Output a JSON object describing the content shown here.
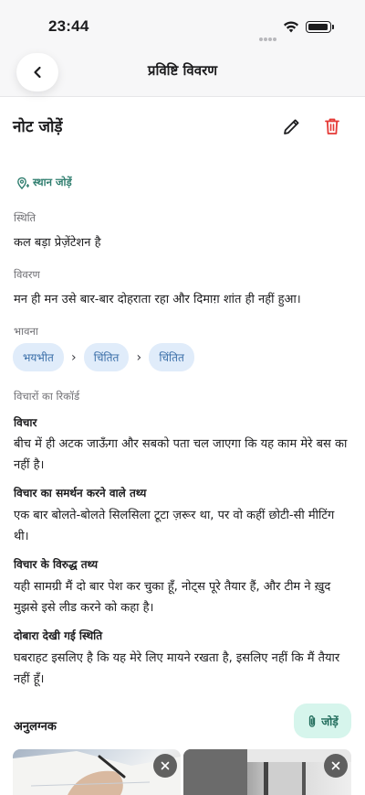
{
  "status": {
    "time": "23:44"
  },
  "nav": {
    "title": "प्रविष्टि विवरण"
  },
  "note": {
    "title": "नोट जोड़ें",
    "add_location": "स्थान जोड़ें"
  },
  "fields": {
    "situation_label": "स्थिति",
    "situation_value": "कल बड़ा प्रेज़ेंटेशन है",
    "description_label": "विवरण",
    "description_value": "मन ही मन उसे बार-बार दोहराता रहा और दिमाग़ शांत ही नहीं हुआ।",
    "emotion_label": "भावना",
    "emotions": [
      "भयभीत",
      "चिंतित",
      "चिंतित"
    ],
    "thoughts_label": "विचारों का रिकॉर्ड"
  },
  "record": {
    "thought_title": "विचार",
    "thought_value": "बीच में ही अटक जाऊँगा और सबको पता चल जाएगा कि यह काम मेरे बस का नहीं है।",
    "support_title": "विचार का समर्थन करने वाले तथ्य",
    "support_value": "एक बार बोलते-बोलते सिलसिला टूटा ज़रूर था, पर वो कहीं छोटी-सी मीटिंग थी।",
    "against_title": "विचार के विरुद्ध तथ्य",
    "against_value": "यही सामग्री मैं दो बार पेश कर चुका हूँ, नोट्स पूरे तैयार हैं, और टीम ने ख़ुद मुझसे इसे लीड करने को कहा है।",
    "revisited_title": "दोबारा देखी गई स्थिति",
    "revisited_value": "घबराहट इसलिए है कि यह मेरे लिए मायने रखता है, इसलिए नहीं कि मैं तैयार नहीं हूँ।"
  },
  "attachments": {
    "title": "अनुलग्नक",
    "add_label": "जोड़ें"
  },
  "colors": {
    "accent": "#2e7d6e",
    "delete": "#e53935",
    "chip_bg": "#e0ecfa",
    "chip_text": "#3a6ea8"
  },
  "icons": [
    "chevron-left-icon",
    "pencil-icon",
    "trash-icon",
    "location-pin-icon",
    "paperclip-icon",
    "close-icon",
    "wifi-icon",
    "battery-icon"
  ]
}
